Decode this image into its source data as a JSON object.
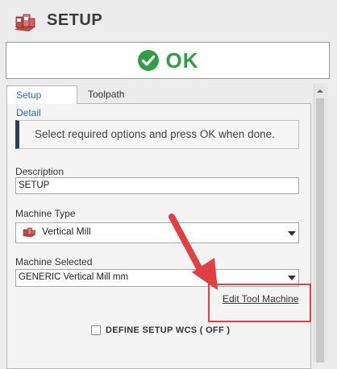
{
  "header": {
    "title": "SETUP",
    "icon": "machine-tool-icon"
  },
  "ok_button": {
    "label": "OK",
    "icon": "check-circle-icon",
    "color": "#2f9e47"
  },
  "tabs": [
    {
      "label": "Setup Detail",
      "active": true
    },
    {
      "label": "Toolpath",
      "active": false
    }
  ],
  "info": {
    "message": "Select required options and press OK when done."
  },
  "description": {
    "label": "Description",
    "value": "SETUP"
  },
  "machine_type": {
    "label": "Machine Type",
    "value": "Vertical Mill",
    "icon": "mill-icon"
  },
  "machine_selected": {
    "label": "Machine Selected",
    "value": "GENERIC Vertical Mill mm"
  },
  "edit_link": {
    "label": "Edit Tool Machine"
  },
  "wcs": {
    "label": "DEFINE SETUP WCS ( OFF )",
    "checked": false
  },
  "annotation": {
    "arrow_color": "#e04040",
    "highlight_color": "#e04040"
  }
}
